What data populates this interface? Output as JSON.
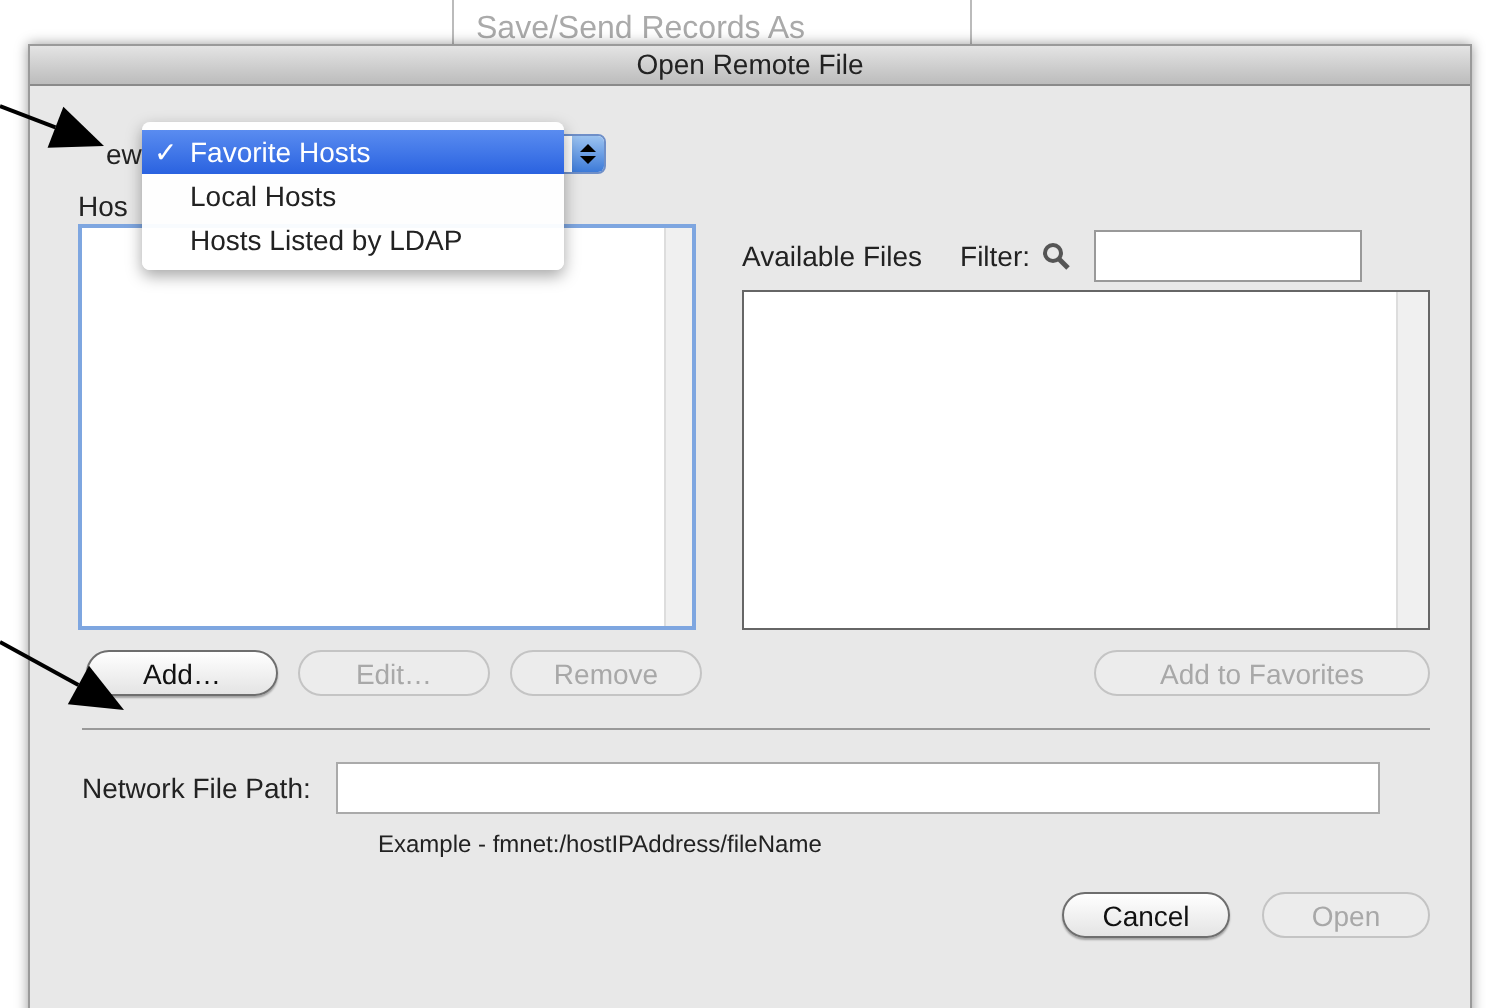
{
  "background_menu_item": "Save/Send Records As",
  "window": {
    "title": "Open Remote File"
  },
  "view": {
    "label": "ew",
    "check_mark": "✓",
    "menu": [
      {
        "label": "Favorite Hosts",
        "selected": true
      },
      {
        "label": "Local Hosts",
        "selected": false
      },
      {
        "label": "Hosts Listed by LDAP",
        "selected": false
      }
    ]
  },
  "hosts": {
    "label": "Hos"
  },
  "host_buttons": [
    {
      "label": "Add…",
      "disabled": false
    },
    {
      "label": "Edit…",
      "disabled": true
    },
    {
      "label": "Remove",
      "disabled": true
    }
  ],
  "available_files": {
    "label": "Available Files",
    "filter_label": "Filter:"
  },
  "add_to_favorites": {
    "label": "Add to Favorites",
    "disabled": true
  },
  "network_file_path": {
    "label": "Network File Path:",
    "example": "Example - fmnet:/hostIPAddress/fileName"
  },
  "buttons": [
    {
      "label": "Cancel",
      "disabled": false
    },
    {
      "label": "Open",
      "disabled": true
    }
  ]
}
